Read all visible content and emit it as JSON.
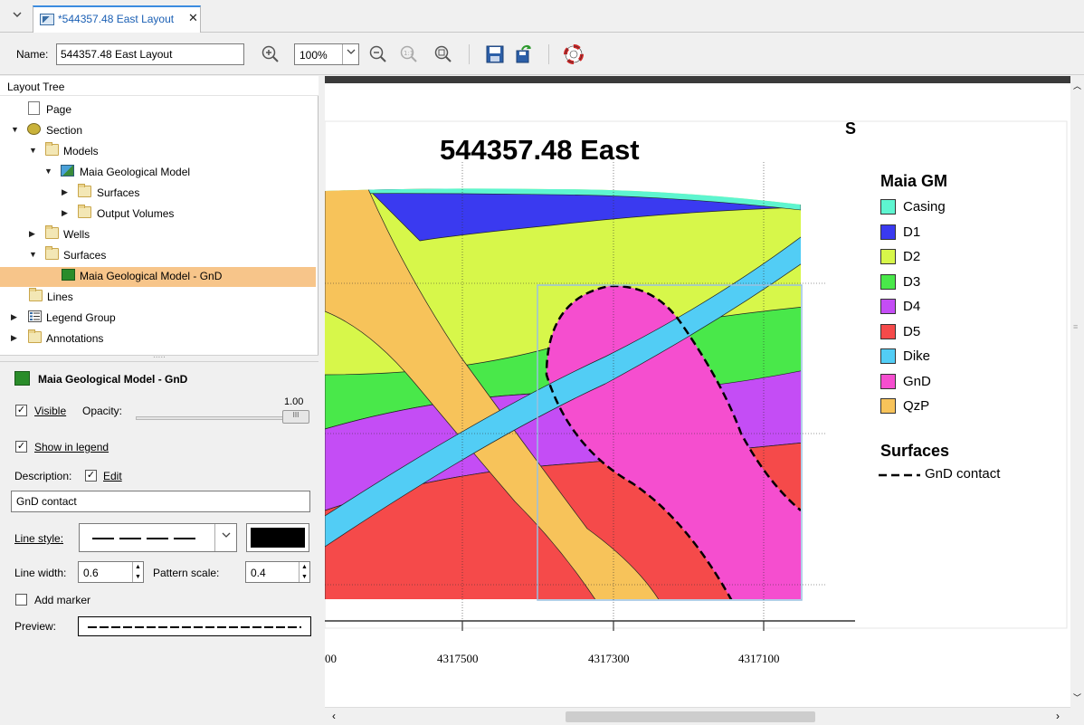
{
  "tab": {
    "title": "*544357.48 East Layout",
    "close": "✕"
  },
  "toolbar": {
    "name_label": "Name:",
    "name_value": "544357.48 East Layout",
    "zoom_value": "100%"
  },
  "layout_tree": {
    "header": "Layout Tree",
    "items": [
      {
        "label": "Page"
      },
      {
        "label": "Section"
      },
      {
        "label": "Models"
      },
      {
        "label": "Maia Geological Model"
      },
      {
        "label": "Surfaces"
      },
      {
        "label": "Output Volumes"
      },
      {
        "label": "Wells"
      },
      {
        "label": "Surfaces"
      },
      {
        "label": "Maia Geological Model - GnD"
      },
      {
        "label": "Lines"
      },
      {
        "label": "Legend Group"
      },
      {
        "label": "Annotations"
      }
    ]
  },
  "properties": {
    "title": "Maia Geological Model - GnD",
    "visible_label": "Visible",
    "opacity_label": "Opacity:",
    "opacity_value": "1.00",
    "show_in_legend_label": "Show in legend",
    "description_label": "Description:",
    "edit_label": "Edit",
    "description_value": "GnD contact",
    "line_style_label": "Line style:",
    "line_width_label": "Line width:",
    "line_width_value": "0.6",
    "pattern_scale_label": "Pattern scale:",
    "pattern_scale_value": "0.4",
    "add_marker_label": "Add marker",
    "preview_label": "Preview:",
    "line_color": "#000000"
  },
  "canvas": {
    "title": "544357.48 East",
    "compass": "S",
    "x_ticks": [
      "00",
      "4317500",
      "4317300",
      "4317100"
    ]
  },
  "legend": {
    "group1_title": "Maia GM",
    "items": [
      {
        "label": "Casing",
        "color": "#5ef5d0"
      },
      {
        "label": "D1",
        "color": "#3a3af0"
      },
      {
        "label": "D2",
        "color": "#d7f74a"
      },
      {
        "label": "D3",
        "color": "#49e84a"
      },
      {
        "label": "D4",
        "color": "#c44df5"
      },
      {
        "label": "D5",
        "color": "#f54a4a"
      },
      {
        "label": "Dike",
        "color": "#52cdf5"
      },
      {
        "label": "GnD",
        "color": "#f54ecf"
      },
      {
        "label": "QzP",
        "color": "#f7c35a"
      }
    ],
    "group2_title": "Surfaces",
    "surface_item": "GnD contact"
  }
}
